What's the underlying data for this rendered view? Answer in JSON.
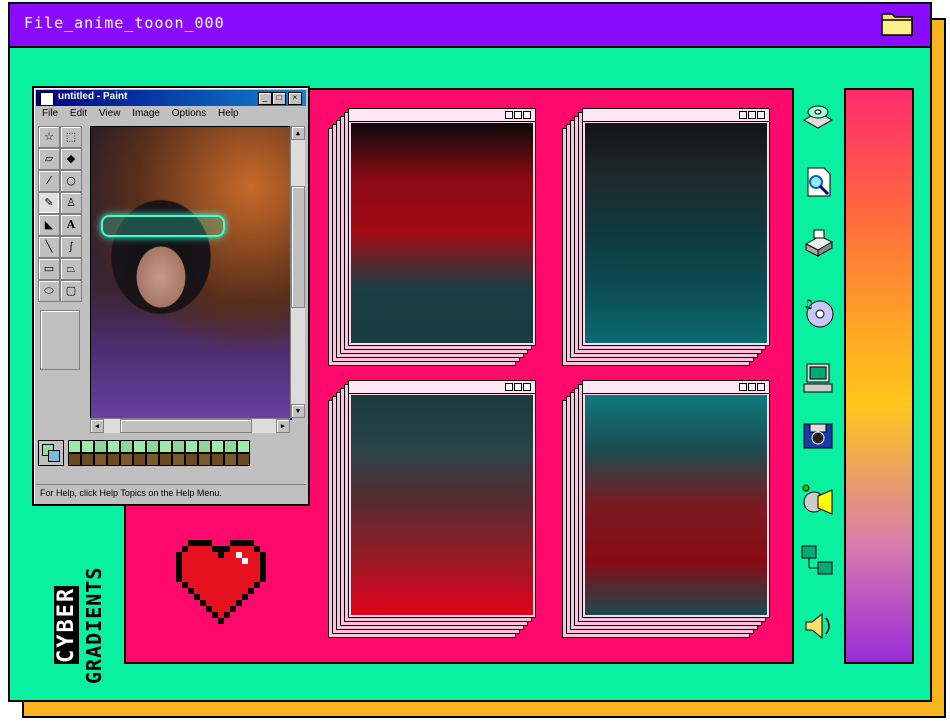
{
  "window": {
    "title": "File_anime_tooon_000",
    "colors": {
      "frame": "#08f0a0",
      "titlebar": "#8a0cff",
      "shadow": "#f6b51e",
      "board": "#ff0a6c"
    }
  },
  "paint": {
    "title": "untitled - Paint",
    "menu": [
      "File",
      "Edit",
      "View",
      "Image",
      "Options",
      "Help"
    ],
    "status": "For Help, click Help Topics on the Help Menu."
  },
  "poster": {
    "line1": "CYBER",
    "line2": "GRADIENTS"
  },
  "gradients": [
    {
      "id": "crimson-teal",
      "stops": [
        "#0a0a0a",
        "#8a0a14",
        "#a30a14",
        "#1b3f44",
        "#183b40"
      ]
    },
    {
      "id": "dark-teal",
      "stops": [
        "#121415",
        "#1e2a2c",
        "#0e3a3e",
        "#0c4c52",
        "#0a6a72"
      ]
    },
    {
      "id": "teal-red",
      "stops": [
        "#1b3a3e",
        "#2a4446",
        "#5a2a30",
        "#9a1a26",
        "#e0001a"
      ]
    },
    {
      "id": "teal-red-teal",
      "stops": [
        "#0f7a7a",
        "#1d4c50",
        "#7a1a22",
        "#8a0a14",
        "#1b4a4e"
      ]
    }
  ],
  "side_icons": [
    "disk-drive-icon",
    "document-search-icon",
    "printer-icon",
    "music-cd-icon",
    "computer-icon",
    "camera-disk-icon",
    "media-player-icon",
    "network-computers-icon",
    "speaker-icon"
  ]
}
